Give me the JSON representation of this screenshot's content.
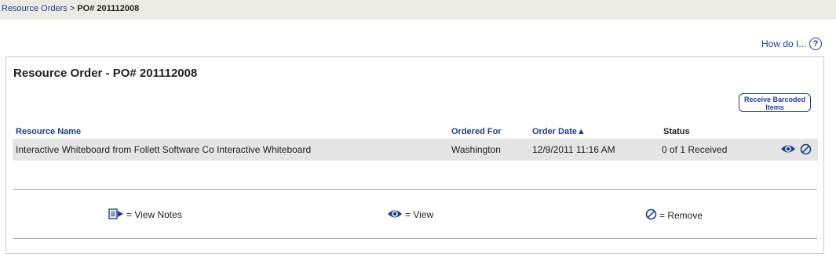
{
  "breadcrumb": {
    "parent": "Resource Orders",
    "separator": ">",
    "current": "PO# 201112008"
  },
  "help": {
    "label": "How do I...",
    "icon_glyph": "?"
  },
  "panel": {
    "title": "Resource Order - PO# 201112008",
    "receive_button_line1": "Receive Barcoded",
    "receive_button_line2": "Items"
  },
  "table": {
    "columns": {
      "resource_name": "Resource Name",
      "ordered_for": "Ordered For",
      "order_date": "Order Date",
      "status": "Status"
    },
    "sort_indicator": "▲",
    "rows": [
      {
        "resource_name": "Interactive Whiteboard from Follett Software Co Interactive Whiteboard",
        "ordered_for": "Washington",
        "order_date": "12/9/2011 11:16 AM",
        "status": "0 of 1 Received"
      }
    ]
  },
  "legend": {
    "view_notes": "= View Notes",
    "view": "= View",
    "remove": "= Remove"
  },
  "colors": {
    "link": "#1b3f8f",
    "topbar": "#ecebe3",
    "row_bg": "#e4e4e4"
  },
  "icons": [
    "help-icon",
    "view-icon",
    "remove-icon",
    "view-notes-icon"
  ]
}
